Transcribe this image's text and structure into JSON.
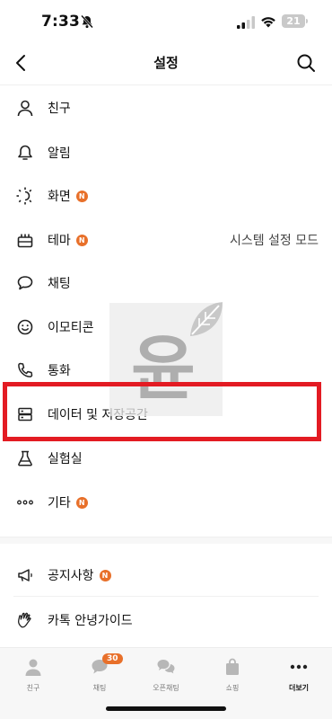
{
  "status_bar": {
    "time": "7:33",
    "battery": "21"
  },
  "header": {
    "title": "설정"
  },
  "menu": [
    {
      "label": "친구",
      "icon": "person-icon"
    },
    {
      "label": "알림",
      "icon": "bell-icon"
    },
    {
      "label": "화면",
      "icon": "sun-icon",
      "badge": "N"
    },
    {
      "label": "테마",
      "icon": "theme-icon",
      "badge": "N",
      "value": "시스템 설정 모드"
    },
    {
      "label": "채팅",
      "icon": "chat-bubble-icon"
    },
    {
      "label": "이모티콘",
      "icon": "smile-icon"
    },
    {
      "label": "통화",
      "icon": "phone-icon"
    },
    {
      "label": "데이터 및 저장공간",
      "icon": "storage-icon"
    },
    {
      "label": "실험실",
      "icon": "flask-icon"
    },
    {
      "label": "기타",
      "icon": "more-dots-icon",
      "badge": "N"
    }
  ],
  "menu2": [
    {
      "label": "공지사항",
      "icon": "megaphone-icon",
      "badge": "N"
    },
    {
      "label": "카톡 안녕가이드",
      "icon": "wave-hand-icon"
    }
  ],
  "watermark": {
    "char": "윤"
  },
  "tabs": [
    {
      "label": "친구",
      "icon": "person-tab-icon"
    },
    {
      "label": "채팅",
      "icon": "chat-tab-icon",
      "badge": "30"
    },
    {
      "label": "오픈채팅",
      "icon": "openchat-tab-icon"
    },
    {
      "label": "쇼핑",
      "icon": "shopping-bag-icon"
    },
    {
      "label": "더보기",
      "icon": "more-tab-icon",
      "active": true
    }
  ],
  "colors": {
    "accent": "#e8702a",
    "highlight": "#e31b23"
  }
}
